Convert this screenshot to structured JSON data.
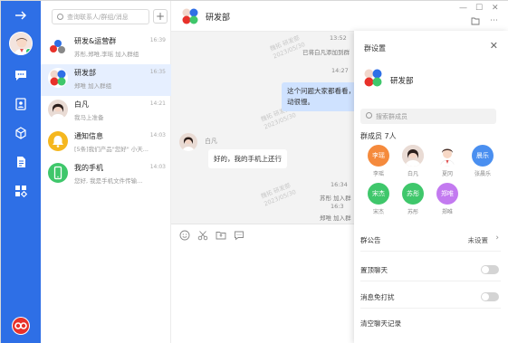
{
  "sidebar": {
    "nav": [
      "back-arrow-icon",
      "chat-icon",
      "contacts-icon",
      "cube-icon",
      "document-icon",
      "apps-grid-icon"
    ]
  },
  "list": {
    "search_placeholder": "查询联系人/群组/消息",
    "conversations": [
      {
        "name": "研发&运营群",
        "sub": "苏彤,郑唯,李瑶 加入群组",
        "time": "16:39"
      },
      {
        "name": "研发部",
        "sub": "郑唯 加入群组",
        "time": "16:35"
      },
      {
        "name": "白凡",
        "sub": "我马上准备",
        "time": "14:21"
      },
      {
        "name": "通知信息",
        "sub": "[5条]我们产品\"您好\" 小天...",
        "time": "14:03"
      },
      {
        "name": "我的手机",
        "sub": "您好, 我是手机文件传输...",
        "time": "14:03"
      }
    ]
  },
  "chat": {
    "title": "研发部",
    "watermarks": [
      {
        "name": "魏拓 研发部",
        "date": "2023/05/30"
      },
      {
        "name": "魏拓 研发部",
        "date": "2023/05/30"
      },
      {
        "name": "魏拓 研发部",
        "date": "2023/05/30"
      }
    ],
    "messages": {
      "t1": "13:52",
      "sys1": "已将白凡添加到群",
      "t2": "14:27",
      "me_text": "这个问题大家都看看，应用启动很慢。",
      "sender": "白凡",
      "in_text": "好的，我的手机上还行",
      "t3": "16:34",
      "sys2": "苏彤 加入群",
      "t4": "16:3",
      "sys3": "郑唯 加入群"
    }
  },
  "panel": {
    "title": "群设置",
    "group_name": "研发部",
    "search_placeholder": "搜索群成员",
    "members_label": "群成员 7人",
    "members": [
      {
        "name": "李瑶",
        "avatar_text": "李瑶",
        "color": "#f58a3c"
      },
      {
        "name": "白凡",
        "avatar_text": "",
        "color": "#e8d9d2"
      },
      {
        "name": "夏冈",
        "avatar_text": "",
        "color": "#f4e3de"
      },
      {
        "name": "张晨乐",
        "avatar_text": "晨乐",
        "color": "#4a8ff0"
      },
      {
        "name": "宋杰",
        "avatar_text": "宋杰",
        "color": "#3fc76b"
      },
      {
        "name": "苏彤",
        "avatar_text": "苏彤",
        "color": "#3fc76b"
      },
      {
        "name": "郑唯",
        "avatar_text": "郑唯",
        "color": "#c37af0"
      }
    ],
    "announcement_label": "群公告",
    "announcement_value": "未设置",
    "pin_label": "置顶聊天",
    "mute_label": "消息免打扰",
    "clear_label": "清空聊天记录"
  }
}
